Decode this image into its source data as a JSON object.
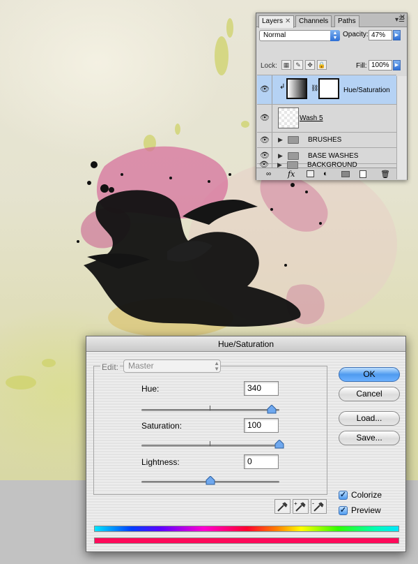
{
  "layers_panel": {
    "tabs": [
      "Layers",
      "Channels",
      "Paths"
    ],
    "blend_mode": "Normal",
    "opacity_label": "Opacity:",
    "opacity_value": "47%",
    "lock_label": "Lock:",
    "fill_label": "Fill:",
    "fill_value": "100%",
    "layers": [
      {
        "name": "Hue/Saturation",
        "selected": true
      },
      {
        "name": "Wash 5",
        "selected": false
      },
      {
        "name": "BRUSHES",
        "type": "group"
      },
      {
        "name": "BASE WASHES",
        "type": "group"
      },
      {
        "name": "BACKGROUND",
        "type": "group"
      }
    ],
    "footer_icons": [
      "link-icon",
      "fx-icon",
      "mask-icon",
      "adjustment-icon",
      "folder-icon",
      "new-layer-icon",
      "trash-icon"
    ],
    "fx_label": "fx"
  },
  "hue_sat_dialog": {
    "title": "Hue/Saturation",
    "edit_label": "Edit:",
    "edit_value": "Master",
    "hue_label": "Hue:",
    "hue_value": "340",
    "hue_level": 0.944,
    "saturation_label": "Saturation:",
    "saturation_value": "100",
    "saturation_level": 1.0,
    "lightness_label": "Lightness:",
    "lightness_value": "0",
    "lightness_level": 0.5,
    "buttons": {
      "ok": "OK",
      "cancel": "Cancel",
      "load": "Load...",
      "save": "Save..."
    },
    "colorize_label": "Colorize",
    "colorize_checked": true,
    "preview_label": "Preview",
    "preview_checked": true,
    "colorize_color": "#ff0a5a"
  }
}
